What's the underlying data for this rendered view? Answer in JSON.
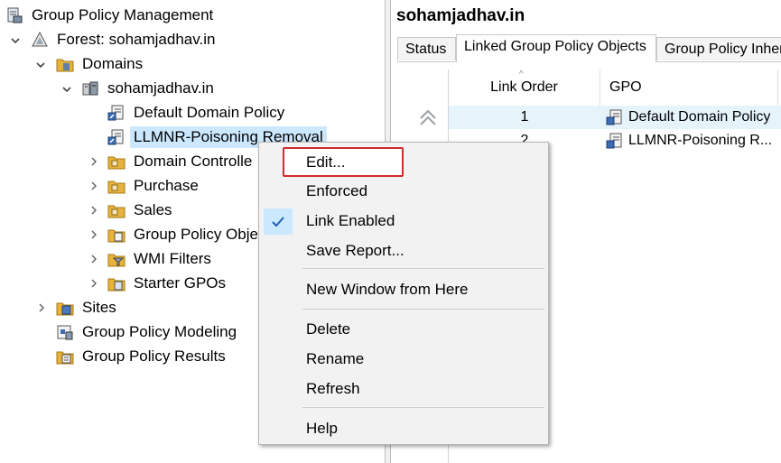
{
  "tree": {
    "root": "Group Policy Management",
    "forest": "Forest: sohamjadhav.in",
    "domains": "Domains",
    "domain": "sohamjadhav.in",
    "default_policy": "Default Domain Policy",
    "llmnr_policy": "LLMNR-Poisoning Removal",
    "domain_controllers": "Domain Controlle",
    "purchase": "Purchase",
    "sales": "Sales",
    "gpo_objects": "Group Policy Obje",
    "wmi": "WMI Filters",
    "starter": "Starter GPOs",
    "sites": "Sites",
    "modeling": "Group Policy Modeling",
    "results": "Group Policy Results"
  },
  "right": {
    "title": "sohamjadhav.in",
    "tabs": [
      "Status",
      "Linked Group Policy Objects",
      "Group Policy Inheri"
    ],
    "columns": [
      "Link Order",
      "GPO"
    ],
    "rows": [
      {
        "order": "1",
        "gpo": "Default Domain Policy"
      },
      {
        "order": "2",
        "gpo": "LLMNR-Poisoning R..."
      }
    ]
  },
  "context_menu": {
    "items": [
      "Edit...",
      "Enforced",
      "Link Enabled",
      "Save Report...",
      "New Window from Here",
      "Delete",
      "Rename",
      "Refresh",
      "Help"
    ],
    "checked": "Link Enabled",
    "highlighted": "Edit..."
  },
  "colors": {
    "selection": "#cce8ff",
    "highlight_border": "#d22b2b",
    "folder": "#e8b33a"
  }
}
